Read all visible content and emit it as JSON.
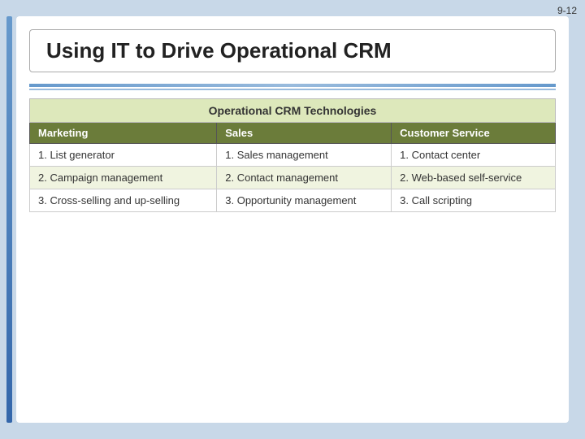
{
  "page": {
    "number": "9-12",
    "title": "Using IT to Drive Operational CRM",
    "table": {
      "section_title": "Operational CRM Technologies",
      "columns": [
        "Marketing",
        "Sales",
        "Customer Service"
      ],
      "rows": [
        [
          "1.  List generator",
          "1.  Sales management",
          "1.  Contact center"
        ],
        [
          "2.  Campaign management",
          "2.  Contact management",
          "2.  Web-based self-service"
        ],
        [
          "3.  Cross-selling and up-selling",
          "3.  Opportunity management",
          "3.  Call scripting"
        ]
      ]
    }
  }
}
